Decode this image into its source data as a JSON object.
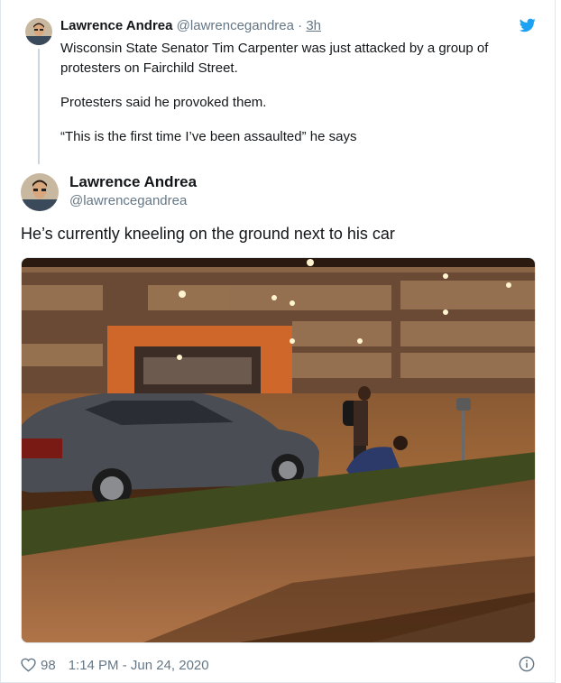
{
  "parent_tweet": {
    "name": "Lawrence Andrea",
    "handle": "@lawrencegandrea",
    "separator": "·",
    "time": "3h",
    "paragraphs": [
      "Wisconsin State Senator Tim Carpenter was just attacked by a group of protesters on Fairchild Street.",
      "Protesters said he provoked them.",
      "“This is the first time I’ve been assaulted” he says"
    ]
  },
  "tweet": {
    "name": "Lawrence Andrea",
    "handle": "@lawrencegandrea",
    "text": "He’s currently kneeling on the ground next to his car"
  },
  "footer": {
    "likes": "98",
    "timestamp": "1:14 PM - Jun 24, 2020"
  },
  "icons": {
    "brand": "twitter-bird-icon",
    "like": "heart-icon",
    "info": "info-icon"
  },
  "colors": {
    "twitter_blue": "#1da1f2",
    "secondary_text": "#657786",
    "primary_text": "#14171a",
    "border": "#e1e8ed"
  }
}
